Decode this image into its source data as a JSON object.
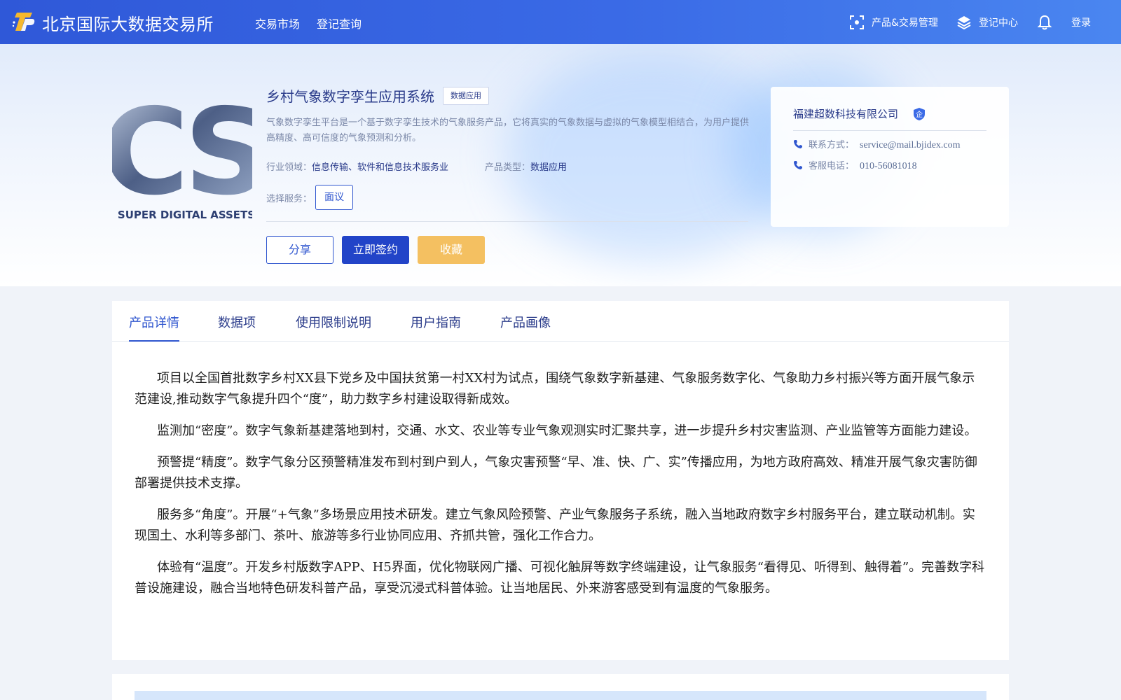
{
  "header": {
    "site_name": "北京国际大数据交易所",
    "nav": [
      {
        "label": "交易市场"
      },
      {
        "label": "登记查询"
      }
    ],
    "right": {
      "product_mgmt": "产品&交易管理",
      "register_center": "登记中心",
      "login": "登录"
    }
  },
  "product": {
    "title": "乡村气象数字孪生应用系统",
    "tag": "数据应用",
    "description": "气象数字孪生平台是一个基于数字孪生技术的气象服务产品，它将真实的气象数据与虚拟的气象模型相结合，为用户提供高精度、高可信度的气象预测和分析。",
    "industry_label": "行业领域：",
    "industry_value": "信息传输、软件和信息技术服务业",
    "type_label": "产品类型：",
    "type_value": "数据应用",
    "service_label": "选择服务：",
    "service_option": "面议",
    "logo_caption": "SUPER DIGITAL ASSETS",
    "logo_letters": "CS"
  },
  "actions": {
    "share": "分享",
    "sign": "立即签约",
    "favorite": "收藏"
  },
  "company": {
    "name": "福建超数科技有限公司",
    "badge": "企",
    "contact_label": "联系方式：",
    "contact_value": "service@mail.bjidex.com",
    "phone_label": "客服电话：",
    "phone_value": "010-56081018"
  },
  "tabs": [
    {
      "label": "产品详情",
      "active": true
    },
    {
      "label": "数据项"
    },
    {
      "label": "使用限制说明"
    },
    {
      "label": "用户指南"
    },
    {
      "label": "产品画像"
    }
  ],
  "detail_paragraphs": [
    "项目以全国首批数字乡村XX县下党乡及中国扶贫第一村XX村为试点，围绕气象数字新基建、气象服务数字化、气象助力乡村振兴等方面开展气象示范建设,推动数字气象提升四个“度”，助力数字乡村建设取得新成效。",
    "监测加“密度”。数字气象新基建落地到村，交通、水文、农业等专业气象观测实时汇聚共享，进一步提升乡村灾害监测、产业监管等方面能力建设。",
    "预警提“精度”。数字气象分区预警精准发布到村到户到人，气象灾害预警“早、准、快、广、实”传播应用，为地方政府高效、精准开展气象灾害防御部署提供技术支撑。",
    "服务多“角度”。开展“+气象”多场景应用技术研发。建立气象风险预警、产业气象服务子系统，融入当地政府数字乡村服务平台，建立联动机制。实现国土、水利等多部门、茶叶、旅游等多行业协同应用、齐抓共管，强化工作合力。",
    "体验有“温度”。开发乡村版数字APP、H5界面，优化物联网广播、可视化触屏等数字终端建设，让气象服务“看得见、听得到、触得着”。完善数字科普设施建设，融合当地特色研发科普产品，享受沉浸式科普体验。让当地居民、外来游客感受到有温度的气象服务。"
  ],
  "colors": {
    "header_start": "#2f58d8",
    "header_end": "#4a86f0",
    "primary": "#2f56cf",
    "sign_button": "#2244c8",
    "favorite_button": "#f4c061",
    "title_text": "#2a3b8a"
  }
}
